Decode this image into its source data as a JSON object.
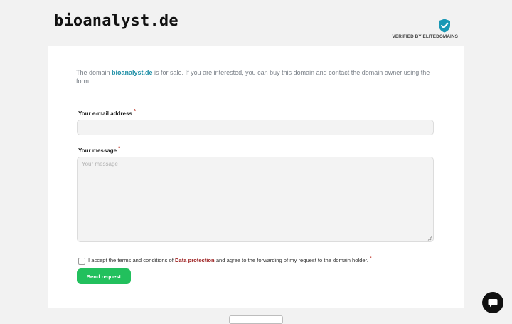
{
  "header": {
    "logo_text": "bioanalyst.de",
    "verified_text": "VERIFIED BY ELITEDOMAINS",
    "verified_icon": "shield-check-icon"
  },
  "intro": {
    "before": "The domain ",
    "domain": "bioanalyst.de",
    "after": " is for sale. If you are interested, you can buy this domain and contact the domain owner using the form."
  },
  "form": {
    "email_label": "Your e-mail address",
    "email_value": "",
    "message_label": "Your message",
    "message_placeholder": "Your message",
    "required_mark": "*",
    "consent_before": "I accept the terms and conditions of ",
    "consent_link": "Data protection",
    "consent_after": " and agree to the forwarding of my request to the domain holder.",
    "submit_label": "Send request"
  },
  "colors": {
    "accent_green": "#22c05d",
    "domain_link": "#1f8fa6",
    "privacy_link": "#9b1c1c",
    "shield": "#1a98b5"
  },
  "chat": {
    "icon": "chat-bubble-icon"
  }
}
